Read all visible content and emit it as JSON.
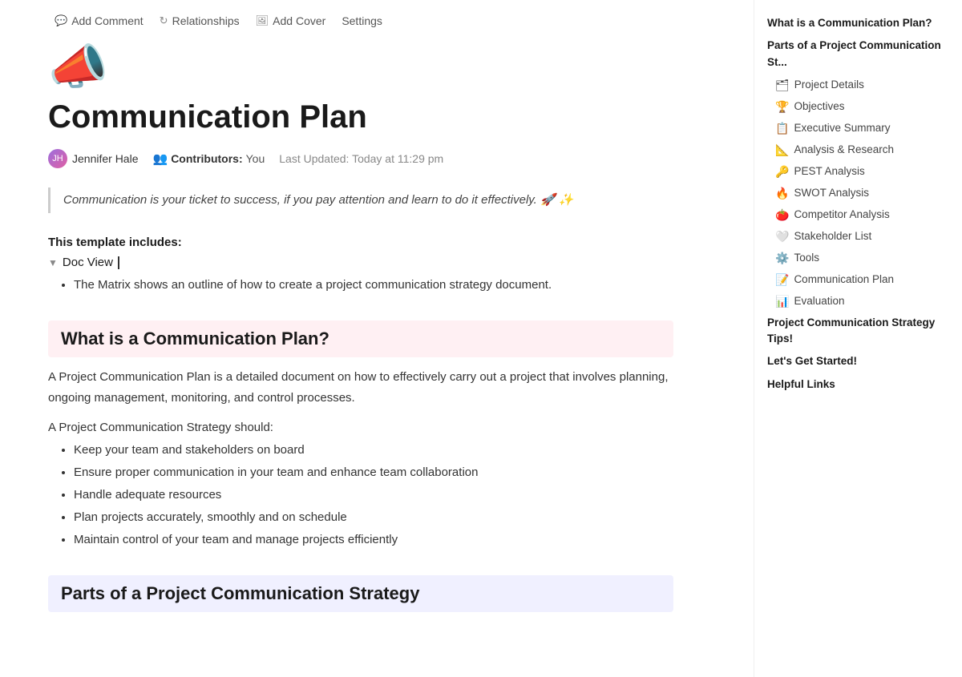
{
  "toolbar": {
    "items": [
      {
        "id": "add-comment",
        "icon": "💬",
        "label": "Add Comment"
      },
      {
        "id": "relationships",
        "icon": "↻",
        "label": "Relationships"
      },
      {
        "id": "add-cover",
        "icon": "🖼",
        "label": "Add Cover"
      },
      {
        "id": "settings",
        "icon": "",
        "label": "Settings"
      }
    ]
  },
  "page": {
    "icon": "📣",
    "title": "Communication Plan",
    "author": {
      "name": "Jennifer Hale",
      "initials": "JH"
    },
    "contributors_label": "Contributors:",
    "contributors_value": "You",
    "last_updated_label": "Last Updated:",
    "last_updated_value": "Today at 11:29 pm"
  },
  "quote": {
    "text": "Communication is your ticket to success, if you pay attention and learn to do it effectively. 🚀 ✨"
  },
  "template": {
    "label": "This template includes:",
    "toggle_text": "Doc View",
    "bullet": "The Matrix shows an outline of how to create a project communication strategy document."
  },
  "sections": [
    {
      "id": "what-is",
      "heading": "What is a Communication Plan?",
      "color": "pink",
      "body1": "A Project Communication Plan is a detailed document on how to effectively carry out a project that involves planning, ongoing management, monitoring, and control processes.",
      "sub_label": "A Project Communication Strategy should:",
      "bullets": [
        "Keep your team and stakeholders on board",
        "Ensure proper communication in your team and enhance team collaboration",
        "Handle adequate resources",
        "Plan projects accurately, smoothly and on schedule",
        "Maintain control of your team and manage projects efficiently"
      ]
    },
    {
      "id": "parts",
      "heading": "Parts of a Project Communication Strategy",
      "color": "lavender"
    }
  ],
  "toc": {
    "items": [
      {
        "id": "what-is-plan",
        "level": "top",
        "emoji": "",
        "label": "What is a Communication Plan?"
      },
      {
        "id": "parts",
        "level": "top",
        "emoji": "",
        "label": "Parts of a Project Communication St..."
      },
      {
        "id": "project-details",
        "level": "sub",
        "emoji": "🗂",
        "label": "Project Details"
      },
      {
        "id": "objectives",
        "level": "sub",
        "emoji": "🏆",
        "label": "Objectives"
      },
      {
        "id": "executive-summary",
        "level": "sub",
        "emoji": "📋",
        "label": "Executive Summary"
      },
      {
        "id": "analysis-research",
        "level": "sub",
        "emoji": "📐",
        "label": "Analysis & Research"
      },
      {
        "id": "pest-analysis",
        "level": "sub",
        "emoji": "🔑",
        "label": "PEST Analysis"
      },
      {
        "id": "swot-analysis",
        "level": "sub",
        "emoji": "🔥",
        "label": "SWOT Analysis"
      },
      {
        "id": "competitor-analysis",
        "level": "sub",
        "emoji": "🍅",
        "label": "Competitor Analysis"
      },
      {
        "id": "stakeholder-list",
        "level": "sub",
        "emoji": "🤍",
        "label": "Stakeholder List"
      },
      {
        "id": "tools",
        "level": "sub",
        "emoji": "⚙️",
        "label": "Tools"
      },
      {
        "id": "communication-plan",
        "level": "sub",
        "emoji": "📝",
        "label": "Communication Plan"
      },
      {
        "id": "evaluation",
        "level": "sub",
        "emoji": "📊",
        "label": "Evaluation"
      },
      {
        "id": "tips",
        "level": "top",
        "emoji": "",
        "label": "Project Communication Strategy Tips!"
      },
      {
        "id": "lets-get-started",
        "level": "top",
        "emoji": "",
        "label": "Let's Get Started!"
      },
      {
        "id": "helpful-links",
        "level": "top",
        "emoji": "",
        "label": "Helpful Links"
      }
    ]
  }
}
